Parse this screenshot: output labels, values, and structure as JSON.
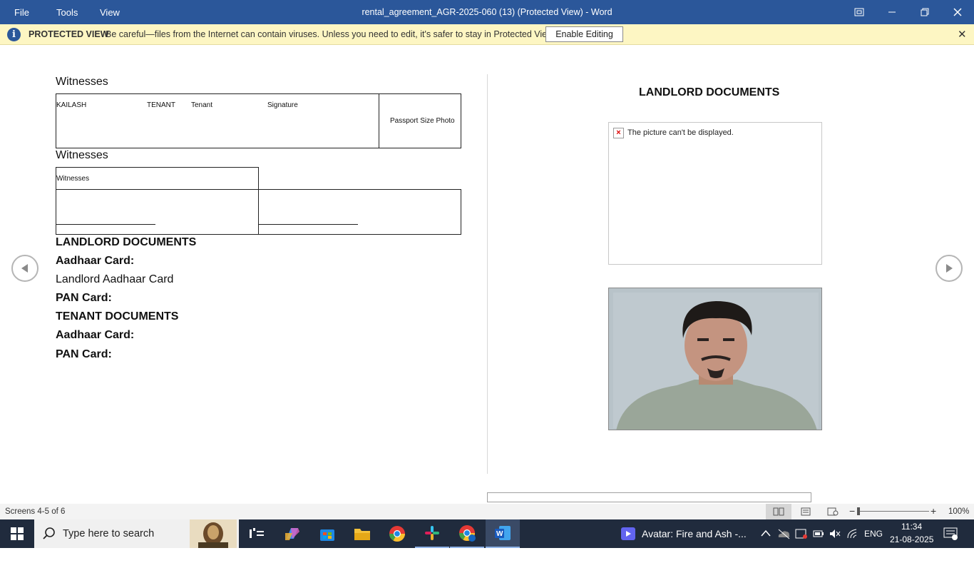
{
  "titlebar": {
    "menus": [
      "File",
      "Tools",
      "View"
    ],
    "title": "rental_agreement_AGR-2025-060 (13) (Protected View) - Word"
  },
  "protected_view": {
    "title": "PROTECTED VIEW",
    "message": "Be careful—files from the Internet can contain viruses. Unless you need to edit, it's safer to stay in Protected View.",
    "button": "Enable Editing"
  },
  "left_page": {
    "witnesses_heading_1": "Witnesses",
    "table1": {
      "c1": "KAILASH",
      "c2": "TENANT",
      "c3": "Tenant",
      "c4": "Signature",
      "photo": "Passport Size Photo"
    },
    "witnesses_heading_2": "Witnesses",
    "table2_label": "Witnesses",
    "landlord_docs": "LANDLORD DOCUMENTS",
    "aadhaar_1": "Aadhaar Card:",
    "landlord_aadhaar": "Landlord Aadhaar Card",
    "pan_1": "PAN Card:",
    "tenant_docs": "TENANT DOCUMENTS",
    "aadhaar_2": "Aadhaar Card:",
    "pan_2": "PAN Card:"
  },
  "right_page": {
    "heading": "LANDLORD DOCUMENTS",
    "broken_image_msg": "The picture can't be displayed."
  },
  "status": {
    "screens": "Screens 4-5 of 6",
    "zoom": "100%"
  },
  "taskbar": {
    "search_placeholder": "Type here to search",
    "media": "Avatar: Fire and Ash -...",
    "lang": "ENG",
    "time": "11:34",
    "date": "21-08-2025"
  },
  "colors": {
    "word_blue": "#2b579a",
    "protected_bg": "#fdf6c3",
    "taskbar": "#202b3d"
  }
}
